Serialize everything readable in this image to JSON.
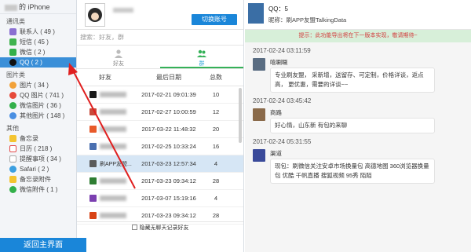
{
  "sidebar": {
    "device": "的 iPhone",
    "categories": [
      {
        "label": "通讯类",
        "items": [
          {
            "label": "联系人 ( 49 )",
            "color": "#8a6fd1"
          },
          {
            "label": "短信 ( 45 )",
            "color": "#3fb34f"
          },
          {
            "label": "微信 ( 2 )",
            "color": "#33b04a"
          },
          {
            "label": "QQ ( 2 )",
            "color": "#111111",
            "active": true
          }
        ]
      },
      {
        "label": "图片类",
        "items": [
          {
            "label": "图片 ( 34 )",
            "color": "#f2a23a"
          },
          {
            "label": "QQ 图片 ( 741 )",
            "color": "#e64a3a"
          },
          {
            "label": "微信图片 ( 36 )",
            "color": "#33b04a"
          },
          {
            "label": "其他图片 ( 148 )",
            "color": "#4a8fe2"
          }
        ]
      },
      {
        "label": "其他",
        "items": [
          {
            "label": "备忘录",
            "color": "#f4c430"
          },
          {
            "label": "日历 ( 218 )",
            "color": "#e24a4a"
          },
          {
            "label": "提醒事项 ( 34 )",
            "color": "#d9d9d9"
          },
          {
            "label": "Safari ( 2 )",
            "color": "#3b9fe0"
          },
          {
            "label": "备忘录附件",
            "color": "#f4c430"
          },
          {
            "label": "微信附件 ( 1 )",
            "color": "#33b04a"
          }
        ]
      }
    ]
  },
  "middle": {
    "switch_button": "切换账号",
    "search_placeholder": "搜索：好友，群",
    "tabs": [
      {
        "label": "好友"
      },
      {
        "label": "群"
      }
    ],
    "columns": [
      "好友",
      "最后日期",
      "总数"
    ],
    "rows": [
      {
        "name": "",
        "date": "2017-02-21 09:01:39",
        "count": "10",
        "color": "#1a1a1a"
      },
      {
        "name": "",
        "date": "2017-02-27 10:00:59",
        "count": "12",
        "color": "#c94a3a"
      },
      {
        "name": "",
        "date": "2017-03-22 11:48:32",
        "count": "20",
        "color": "#e85a2a"
      },
      {
        "name": "",
        "date": "2017-02-25 10:33:24",
        "count": "16",
        "color": "#4a6fb0"
      },
      {
        "name": "刷APP友盟...",
        "date": "2017-03-23 12:57:34",
        "count": "4",
        "color": "#5a5a5a",
        "selected": true
      },
      {
        "name": "",
        "date": "2017-03-23 09:34:12",
        "count": "28",
        "color": "#2e7d32"
      },
      {
        "name": "",
        "date": "2017-03-07 15:19:16",
        "count": "4",
        "color": "#7b3fb0"
      },
      {
        "name": "",
        "date": "2017-03-23 09:34:12",
        "count": "28",
        "color": "#d84315"
      }
    ],
    "footer_checkbox": "隐藏无聊天记录好友",
    "back_button": "返回主界面"
  },
  "chat": {
    "qq_label": "QQ：5",
    "nickname": "昵称：刷APP友盟TalkingData",
    "notice": "提示：此功能导出将在下一版本实现，敬请期待~",
    "messages": [
      {
        "time": "2017-02-24 03:11:59",
        "sender": "嘻唰唰",
        "text": "专业刷友盟，                    采新增，送留存、可定制，价格详谈，返点高，         更优惠，需要的详谈~~",
        "avatar": "#5a6d82"
      },
      {
        "time": "2017-02-24 03:45:42",
        "sender": "商路",
        "text": "好心情，山东新         有包的来聊",
        "avatar": "#8a6a4a"
      },
      {
        "time": "2017-02-24 05:31:55",
        "sender": "渠道",
        "text": "现包：刷微信关注安卓市场换量包 高德地图 360浏览器换量包 优酷 千帆直播 搜狐视频 95秀 陌陌",
        "avatar": "#3a4a9a"
      }
    ]
  }
}
